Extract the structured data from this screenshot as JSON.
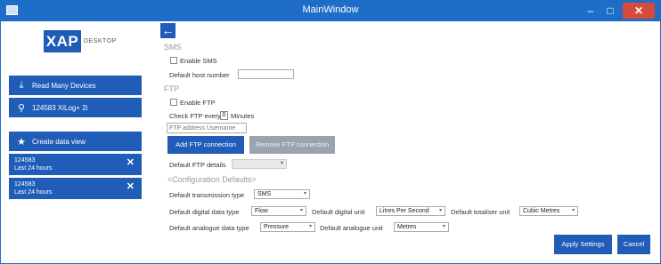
{
  "window": {
    "title": "MainWindow",
    "min": "–",
    "max": "□",
    "close": "✕"
  },
  "logo": {
    "mark": "XAP",
    "text": "DESKTOP"
  },
  "sidebar": {
    "read_many": "Read Many Devices",
    "search_value": "124583 XiLog+ 2i",
    "create_view": "Create data view",
    "cards": [
      {
        "id": "124583",
        "range": "Last 24 hours",
        "close": "✕"
      },
      {
        "id": "124583",
        "range": "Last 24 hours",
        "close": "✕"
      }
    ]
  },
  "back_glyph": "←",
  "sms": {
    "section": "SMS",
    "enable_label": "Enable SMS",
    "host_label": "Default host number",
    "host_value": ""
  },
  "ftp": {
    "section": "FTP",
    "enable_label": "Enable FTP",
    "check_pre": "Check FTP every",
    "check_value": "0",
    "check_post": "Minutes",
    "address_placeholder": "FTP address Username",
    "add_button": "Add FTP connection",
    "remove_button": "Remove FTP connection",
    "default_details_label": "Default FTP details",
    "default_details_value": ""
  },
  "config": {
    "section": "<Configuration Defaults>",
    "transmission_label": "Default transmission type",
    "transmission_value": "SMS",
    "digital_type_label": "Default digital data type",
    "digital_type_value": "Flow",
    "digital_unit_label": "Default digital unit",
    "digital_unit_value": "Litres Per Second",
    "totaliser_label": "Default totaliser unit",
    "totaliser_value": "Cubic Metres",
    "analogue_type_label": "Default analogue data type",
    "analogue_type_value": "Pressure",
    "analogue_unit_label": "Default analogue unit",
    "analogue_unit_value": "Metres"
  },
  "actions": {
    "apply": "Apply Settings",
    "cancel": "Cancel"
  },
  "colors": {
    "titlebar": "#1e6ec8",
    "accent": "#1f5db8",
    "close": "#d54a3a"
  }
}
